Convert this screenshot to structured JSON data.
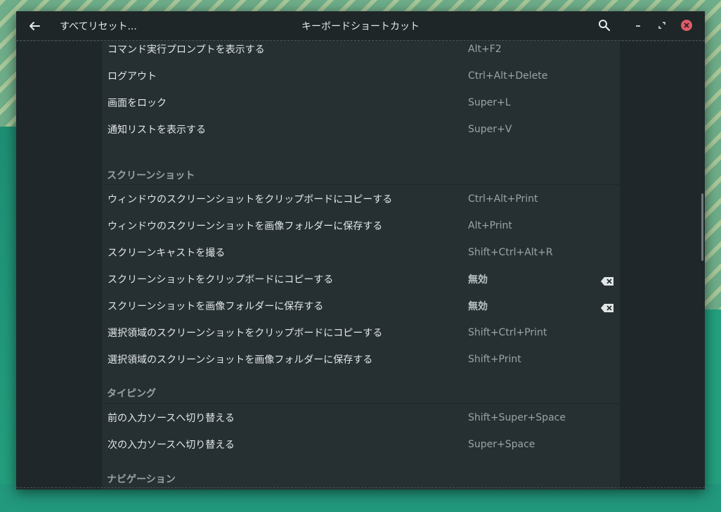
{
  "header": {
    "back_icon": "arrow-left-icon",
    "reset_label": "すべてリセット...",
    "title": "キーボードショートカット",
    "search_icon": "search-icon",
    "minimize_icon": "minimize-icon",
    "maximize_icon": "maximize-icon",
    "close_icon": "close-icon"
  },
  "rows_top": [
    {
      "label": "コマンド実行プロンプトを表示する",
      "accel": "Alt+F2"
    },
    {
      "label": "ログアウト",
      "accel": "Ctrl+Alt+Delete"
    },
    {
      "label": "画面をロック",
      "accel": "Super+L"
    },
    {
      "label": "通知リストを表示する",
      "accel": "Super+V"
    }
  ],
  "sections": {
    "screenshot": "スクリーンショット",
    "typing": "タイピング",
    "navigation": "ナビゲーション"
  },
  "rows_screenshot": [
    {
      "label": "ウィンドウのスクリーンショットをクリップボードにコピーする",
      "accel": "Ctrl+Alt+Print"
    },
    {
      "label": "ウィンドウのスクリーンショットを画像フォルダーに保存する",
      "accel": "Alt+Print"
    },
    {
      "label": "スクリーンキャストを撮る",
      "accel": "Shift+Ctrl+Alt+R"
    },
    {
      "label": "スクリーンショットをクリップボードにコピーする",
      "accel": "無効"
    },
    {
      "label": "スクリーンショットを画像フォルダーに保存する",
      "accel": "無効"
    },
    {
      "label": "選択領域のスクリーンショットをクリップボードにコピーする",
      "accel": "Shift+Ctrl+Print"
    },
    {
      "label": "選択領域のスクリーンショットを画像フォルダーに保存する",
      "accel": "Shift+Print"
    }
  ],
  "rows_typing": [
    {
      "label": "前の入力ソースへ切り替える",
      "accel": "Shift+Super+Space"
    },
    {
      "label": "次の入力ソースへ切り替える",
      "accel": "Super+Space"
    }
  ],
  "clear_icon": "backspace-clear-icon"
}
